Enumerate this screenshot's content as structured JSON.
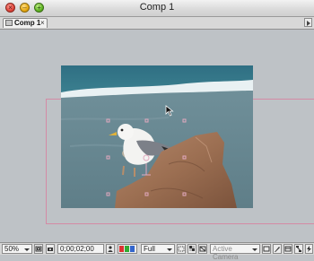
{
  "window": {
    "title": "Comp 1"
  },
  "traffic_lights": {
    "close": "×",
    "minimize": "–",
    "zoom": "+"
  },
  "tab": {
    "label": "Comp 1",
    "close_glyph": "×"
  },
  "viewer": {
    "bounds_color": "#d48aa5",
    "handle_color": "#e2a9bf"
  },
  "toolbar": {
    "zoom": "50%",
    "timecode": "0;00;02;00",
    "resolution": "Full",
    "view": "Active Camera"
  }
}
